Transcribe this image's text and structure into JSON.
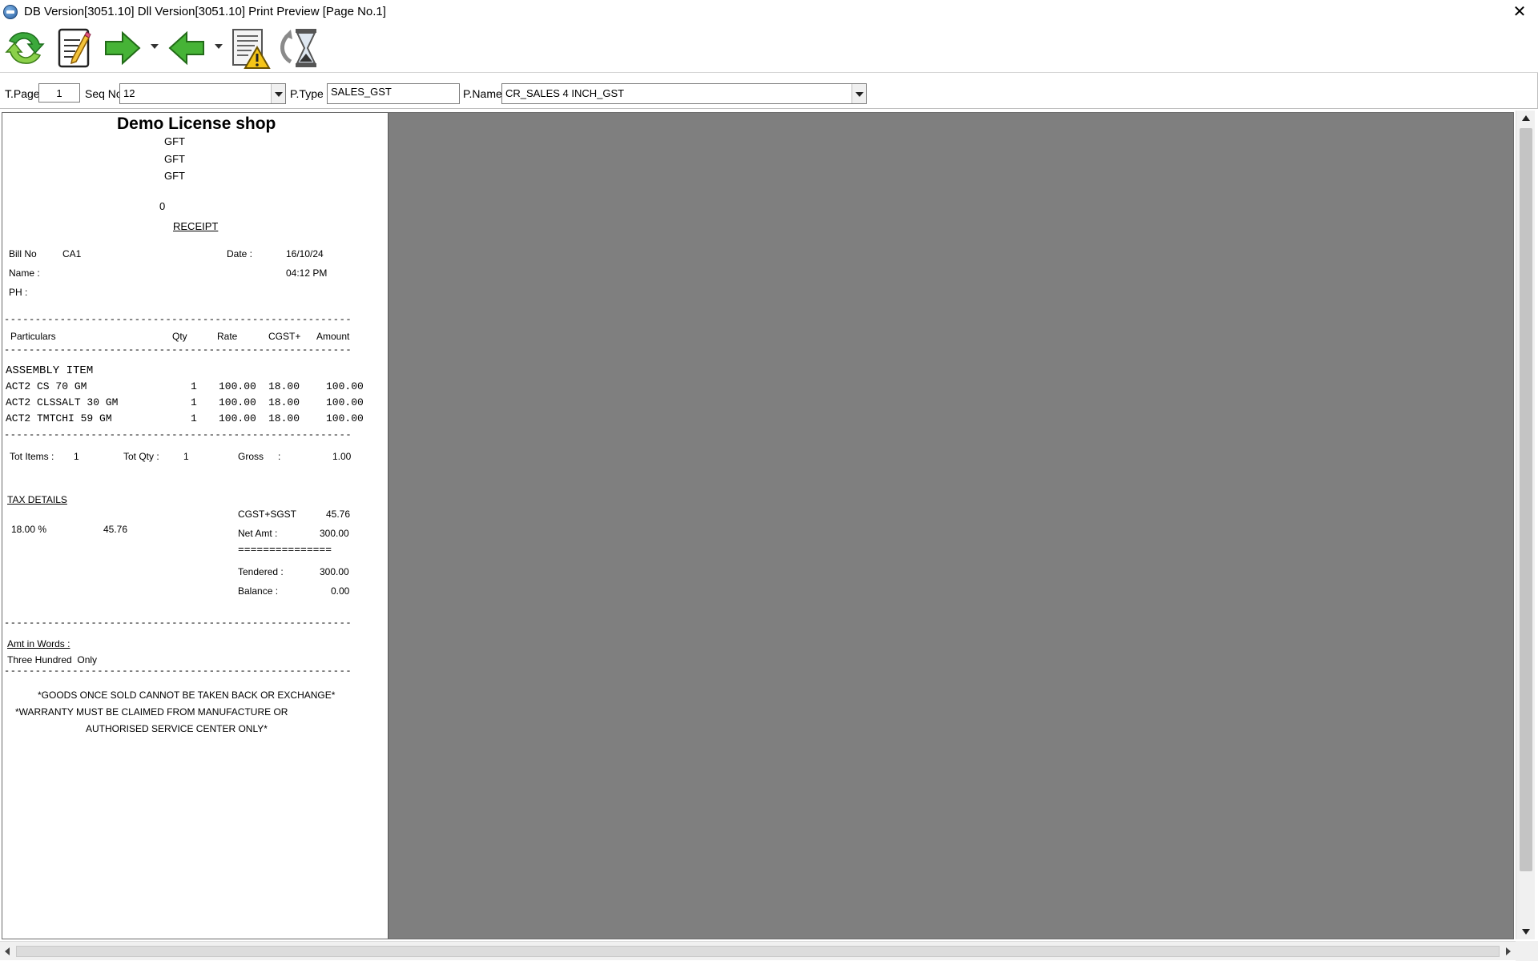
{
  "window": {
    "title": "DB Version[3051.10] Dll Version[3051.10] Print Preview [Page No.1]",
    "close_glyph": "✕"
  },
  "toolbar": {
    "buttons": [
      "refresh-icon",
      "edit-document-icon",
      "next-page-icon",
      "previous-page-icon",
      "report-warning-icon",
      "history-hourglass-icon"
    ]
  },
  "filters": {
    "tpage_label": "T.Page",
    "tpage_value": "1",
    "seqno_label": "Seq No",
    "seqno_value": "12",
    "ptype_label": "P.Type",
    "ptype_value": "SALES_GST",
    "pname_label": "P.Name",
    "pname_value": "CR_SALES 4 INCH_GST"
  },
  "receipt": {
    "shop_name": "Demo License shop",
    "addr1": "GFT",
    "addr2": "GFT",
    "addr3": "GFT",
    "zero": "0",
    "doc_title": "RECEIPT",
    "billno_label": "Bill No",
    "billno_value": "CA1",
    "date_label": "Date :",
    "date_value": "16/10/24",
    "name_label": "Name :",
    "time_value": "04:12 PM",
    "ph_label": "PH :",
    "dash_line": "--------------------------------------------------------",
    "col_particulars": "Particulars",
    "col_qty": "Qty",
    "col_rate": "Rate",
    "col_cgst": "CGST+",
    "col_amount": "Amount",
    "group_heading": "ASSEMBLY ITEM",
    "items": [
      {
        "name": "ACT2 CS 70 GM",
        "qty": "1",
        "rate": "100.00",
        "tax": "18.00",
        "amount": "100.00"
      },
      {
        "name": "ACT2 CLSSALT 30 GM",
        "qty": "1",
        "rate": "100.00",
        "tax": "18.00",
        "amount": "100.00"
      },
      {
        "name": "ACT2 TMTCHI 59 GM",
        "qty": "1",
        "rate": "100.00",
        "tax": "18.00",
        "amount": "100.00"
      }
    ],
    "tot_items_label": "Tot Items :",
    "tot_items_value": "1",
    "tot_qty_label": "Tot Qty :",
    "tot_qty_value": "1",
    "gross_label": "Gross",
    "gross_colon": ":",
    "gross_value": "1.00",
    "tax_details_label": "TAX DETAILS",
    "tax_rate": "18.00 %",
    "tax_amount": "45.76",
    "cgst_sgst_label": "CGST+SGST",
    "cgst_sgst_value": "45.76",
    "netamt_label": "Net Amt :",
    "netamt_value": "300.00",
    "equals_line": "===============",
    "tendered_label": "Tendered :",
    "tendered_value": "300.00",
    "balance_label": "Balance :",
    "balance_value": "0.00",
    "amt_words_label": "Amt in Words :",
    "amt_words_value": "Three Hundred  Only",
    "footer1": "*GOODS ONCE SOLD CANNOT BE TAKEN BACK OR EXCHANGE*",
    "footer2": "*WARRANTY MUST BE CLAIMED FROM MANUFACTURE OR",
    "footer3": "AUTHORISED SERVICE CENTER ONLY*"
  },
  "colors": {
    "preview_bg": "#7f7f7f",
    "paper_bg": "#ffffff",
    "arrow_green": "#46b336"
  }
}
